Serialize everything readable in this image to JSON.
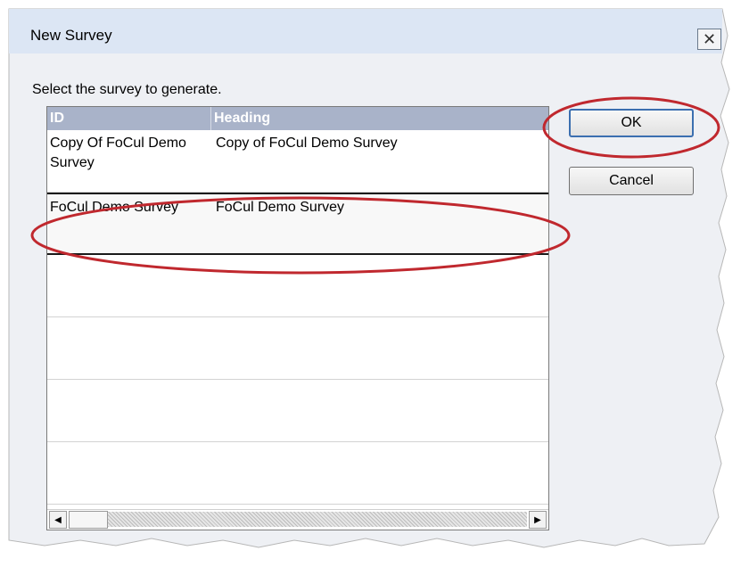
{
  "window": {
    "title": "New Survey",
    "close_glyph": "✕"
  },
  "prompt": "Select the survey to generate.",
  "list": {
    "columns": [
      "ID",
      "Heading"
    ],
    "rows": [
      {
        "id": "Copy Of FoCul Demo Survey",
        "heading": "Copy of FoCul Demo Survey"
      },
      {
        "id": "FoCul Demo Survey",
        "heading": "FoCul Demo Survey",
        "selected": true
      }
    ],
    "empty_rows": 4,
    "scroll_left_glyph": "◀",
    "scroll_right_glyph": "▶"
  },
  "buttons": {
    "ok": "OK",
    "cancel": "Cancel"
  },
  "icons": [
    "close-icon",
    "scroll-left-icon",
    "scroll-right-icon"
  ],
  "colors": {
    "header_bg": "#a9b3c9",
    "annotation": "#c0282e"
  }
}
